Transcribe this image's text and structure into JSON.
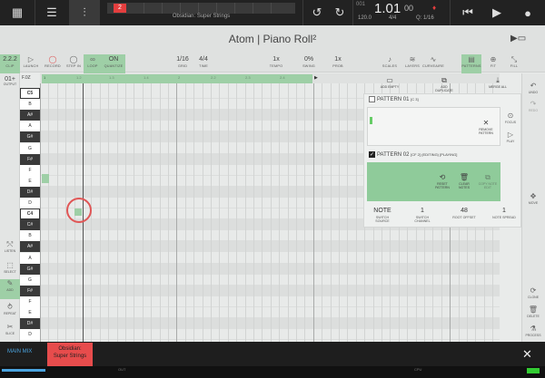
{
  "topbar": {
    "marker": "2",
    "track_name": "Obsidian: Super Strings",
    "position_main": "1.01",
    "position_sub": "00",
    "position_bar": "001",
    "tempo": "120.0",
    "signature": "4/4",
    "quantize": "Q: 1/16",
    "marker_bar": "2"
  },
  "title": {
    "text": "Atom | Piano Roll²"
  },
  "toolbar": {
    "clip_value": "2.2.2",
    "clip_label": "CLIP",
    "launch_label": "LAUNCH",
    "record_label": "RECORD",
    "stepin_label": "STEP IN",
    "loop_label": "LOOP",
    "quantize_value": "ON",
    "quantize_label": "QUANTIZE",
    "grid_value": "1/16",
    "grid_label": "GRID",
    "time_value": "4/4",
    "time_label": "TIME",
    "tempo_value": "1x",
    "tempo_label": "TEMPO",
    "swing_value": "0%",
    "swing_label": "SWING",
    "prob_value": "1x",
    "prob_label": "PROB",
    "scales_label": "SCALES",
    "layers_label": "LAYERS",
    "curveaire_label": "CURVEAIRE",
    "patterns_label": "PATTERNS",
    "fit_label": "FIT",
    "fill_label": "FILL"
  },
  "left": {
    "output_value": "01+",
    "output_label": "OUTPUT",
    "listen_label": "LISTEN",
    "select_label": "SELECT",
    "add_label": "ADD",
    "repeat_label": "REPEAT",
    "slice_label": "SLICE"
  },
  "keys": {
    "range_label": "F.0Z",
    "c5": "C5",
    "c4": "C4",
    "names": [
      "B",
      "A#",
      "A",
      "G#",
      "G",
      "F#",
      "F",
      "E",
      "D#",
      "D",
      "C#",
      "B",
      "A#",
      "A",
      "G#",
      "G",
      "F#",
      "F",
      "E",
      "D#",
      "D"
    ]
  },
  "ruler": {
    "start": "1",
    "marks": [
      "1.2",
      "1.3",
      "1.4",
      "2",
      "2.2",
      "2.3",
      "2.4"
    ]
  },
  "right": {
    "undo_label": "UNDO",
    "redo_label": "REDO",
    "move_label": "MOVE",
    "clone_label": "CLONE",
    "delete_label": "DELETE",
    "process_label": "PROCESS",
    "focus_label": "FOCUS",
    "play_label": "PLAY"
  },
  "patterns": {
    "add_empty": "ADD EMPTY",
    "add_duplicate": "ADD DUPLICATE",
    "merge_all": "MERGE ALL",
    "p1_title": "PATTERN 01",
    "p1_tag": "[C 3]",
    "p1_remove": "REMOVE PATTERN",
    "p2_title": "PATTERN 02",
    "p2_tag": "[CF 2] (EDITING) [PLAYING]",
    "p2_reset": "RESET PATTERN",
    "p2_clear": "CLEAR NOTES",
    "p2_copy": "COPY NOTE EDIT",
    "note_label": "NOTE",
    "switch_source": "SWITCH SOURCE",
    "switch_channel_value": "1",
    "switch_channel": "SWITCH CHANNEL",
    "root_offset_value": "48",
    "root_offset": "ROOT OFFSET",
    "note_spread_value": "1",
    "note_spread": "NOTE SPREAD"
  },
  "bottom": {
    "main_mix": "MAIN MIX",
    "track_line1": "Obsidian:",
    "track_line2": "Super Strings",
    "meter_label_l": "OUT",
    "meter_label_r": "CPU"
  },
  "colors": {
    "accent_green": "#9ecfa6",
    "track_red": "#e74c4c",
    "mix_blue": "#4aa3df"
  }
}
